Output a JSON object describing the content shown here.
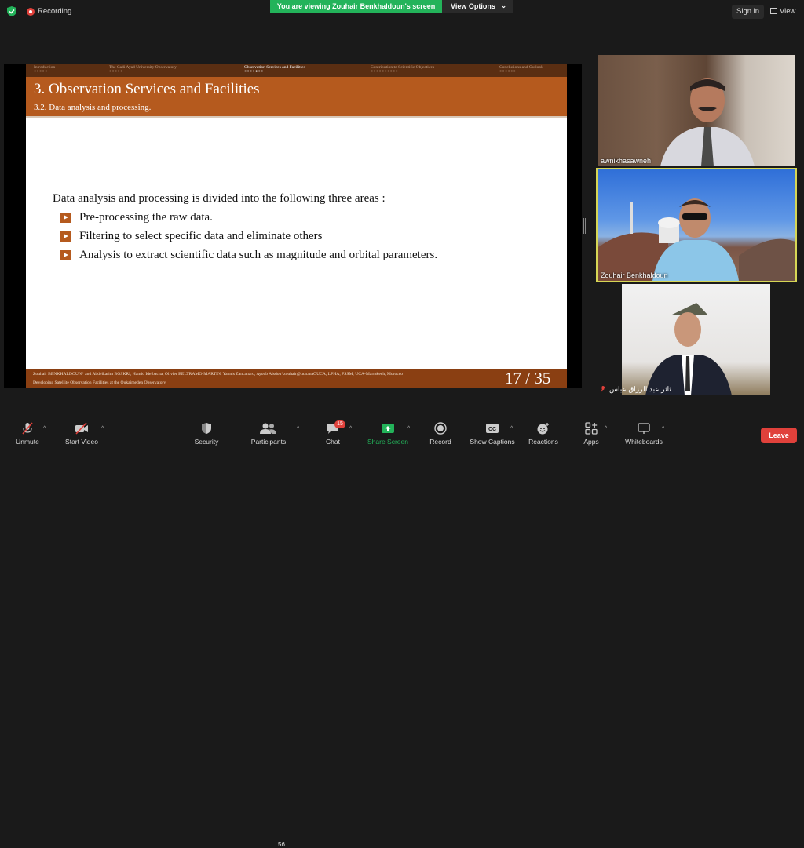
{
  "topbar": {
    "recording_label": "Recording",
    "banner": "You are viewing Zouhair Benkhaldoun's screen",
    "view_options": "View Options",
    "sign_in": "Sign in",
    "view": "View"
  },
  "slide": {
    "nav": [
      {
        "label": "Introduction",
        "dots": "○○○○○"
      },
      {
        "label": "The Cadi Ayad University Observatory",
        "dots": "○○○○○"
      },
      {
        "label": "Observation Services and Facilities",
        "dots": "○○○○●○○"
      },
      {
        "label": "Contribution to Scientific Objectives",
        "dots": "○○○○○○○○○○"
      },
      {
        "label": "Conclusions and Outlook",
        "dots": "○○○○○○"
      }
    ],
    "title": "3.  Observation Services and Facilities",
    "subtitle": "3.2.  Data analysis and processing.",
    "intro": "Data analysis and processing is divided into the following three areas :",
    "bullets": [
      "Pre-processing the raw data.",
      "Filtering to select specific data and eliminate others",
      "Analysis to extract scientific data such as magnitude and orbital parameters."
    ],
    "footer_authors": "Zouhair BENKHALDOUN* and Abdelkarim BOSKRI, Hamid Idelbacha, Olivier BELTRAMO-MARTIN, Yannis Zancanaro, Ayoub Alsdou*zouhair@uca.maOUCA, LPHA, FSSM, UCA-Marrakech, Morocco",
    "footer_title": "Developing Satellite Observation Facilities at the Oukaimeden Observatory",
    "page": "17 / 35"
  },
  "participants": [
    {
      "name": "awnikhasawneh"
    },
    {
      "name": "Zouhair Benkhaldoun"
    },
    {
      "name": "ثائر عبد الرزاق عباس"
    }
  ],
  "toolbar": {
    "unmute": "Unmute",
    "start_video": "Start Video",
    "security": "Security",
    "participants": "Participants",
    "participants_count": "56",
    "chat": "Chat",
    "chat_badge": "15",
    "share_screen": "Share Screen",
    "record": "Record",
    "show_captions": "Show Captions",
    "reactions": "Reactions",
    "apps": "Apps",
    "whiteboards": "Whiteboards",
    "leave": "Leave"
  },
  "colors": {
    "banner_green": "#23b35a",
    "slide_orange": "#b55a1e",
    "slide_brown": "#5a2e12",
    "leave_red": "#e0413b",
    "active_speaker": "#d6d655"
  }
}
